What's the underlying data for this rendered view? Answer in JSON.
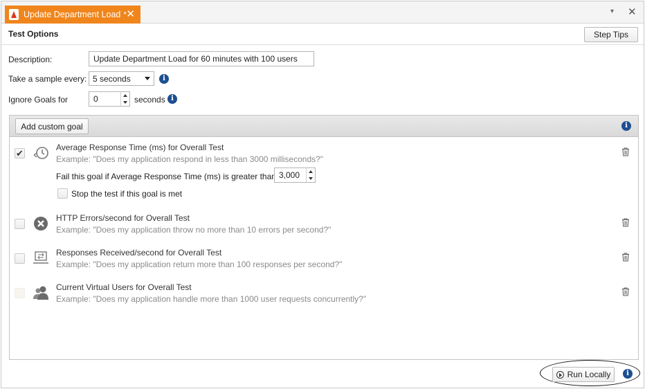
{
  "tab": {
    "title": "Update Department Load",
    "dirty_marker": "*",
    "close_glyph": "✕"
  },
  "window": {
    "menu_glyph": "▾",
    "close_glyph": "✕"
  },
  "header": {
    "title": "Test Options",
    "step_tips_label": "Step Tips"
  },
  "form": {
    "description_label": "Description:",
    "description_value": "Update Department Load for 60 minutes with 100 users",
    "sample_label": "Take a sample every:",
    "sample_value": "5 seconds",
    "ignore_label": "Ignore Goals for",
    "ignore_value": "0",
    "ignore_unit": "seconds"
  },
  "goals_toolbar": {
    "add_label": "Add custom goal"
  },
  "goals": [
    {
      "checked": true,
      "check_glyph": "✔",
      "icon": "clock-icon",
      "title": "Average Response Time (ms) for Overall Test",
      "example": "Example: \"Does my application respond in less than 3000 milliseconds?\"",
      "fail_label": "Fail this goal if Average Response Time (ms) is greater than",
      "fail_value": "3,000",
      "stop_label": "Stop the test if this goal is met"
    },
    {
      "checked": false,
      "icon": "error-icon",
      "title": "HTTP Errors/second for Overall Test",
      "example": "Example: \"Does my application throw no more than 10 errors per second?\""
    },
    {
      "checked": false,
      "icon": "laptop-transfer-icon",
      "title": "Responses Received/second for Overall Test",
      "example": "Example: \"Does my application return more than 100 responses per second?\""
    },
    {
      "checked": false,
      "icon": "users-icon",
      "title": "Current Virtual Users for Overall Test",
      "example": "Example: \"Does my application handle more than 1000 user requests concurrently?\""
    }
  ],
  "footer": {
    "run_label": "Run Locally"
  },
  "colors": {
    "tab_accent": "#f0851b",
    "info_blue": "#1d4f91"
  }
}
